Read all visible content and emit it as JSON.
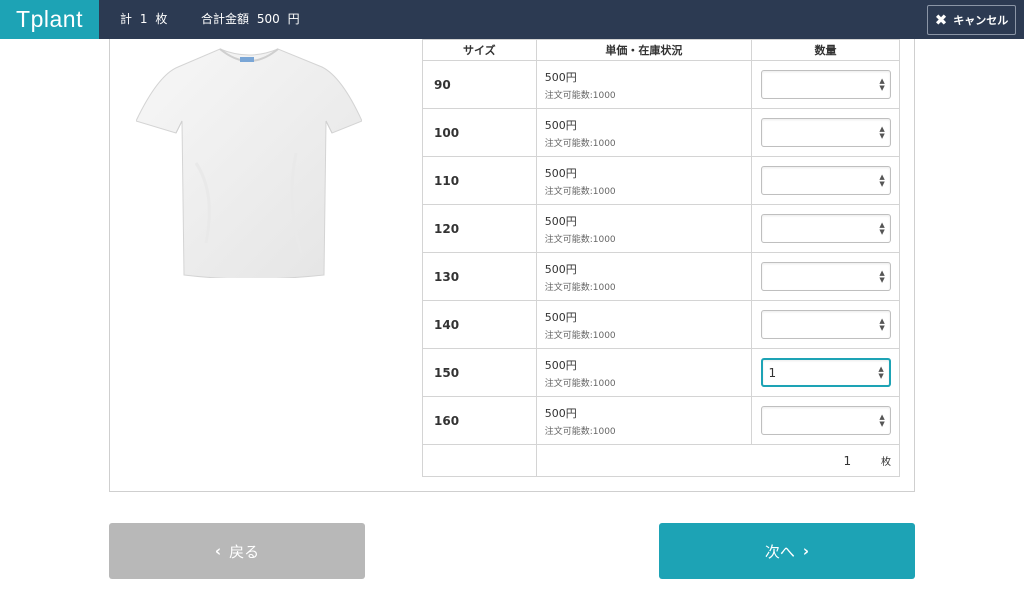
{
  "header": {
    "logo": "Tplant",
    "count_label": "計",
    "count_value": "1",
    "count_unit": "枚",
    "total_label": "合計金額",
    "total_value": "500",
    "total_unit": "円",
    "cancel_label": "キャンセル"
  },
  "table": {
    "headers": [
      "サイズ",
      "単価・在庫状況",
      "数量"
    ],
    "rows": [
      {
        "size": "90",
        "price": "500円",
        "stock": "注文可能数:1000",
        "qty": ""
      },
      {
        "size": "100",
        "price": "500円",
        "stock": "注文可能数:1000",
        "qty": ""
      },
      {
        "size": "110",
        "price": "500円",
        "stock": "注文可能数:1000",
        "qty": ""
      },
      {
        "size": "120",
        "price": "500円",
        "stock": "注文可能数:1000",
        "qty": ""
      },
      {
        "size": "130",
        "price": "500円",
        "stock": "注文可能数:1000",
        "qty": ""
      },
      {
        "size": "140",
        "price": "500円",
        "stock": "注文可能数:1000",
        "qty": ""
      },
      {
        "size": "150",
        "price": "500円",
        "stock": "注文可能数:1000",
        "qty": "1"
      },
      {
        "size": "160",
        "price": "500円",
        "stock": "注文可能数:1000",
        "qty": ""
      }
    ],
    "total_qty": "1",
    "total_unit": "枚"
  },
  "buttons": {
    "back": "戻る",
    "next": "次へ"
  },
  "colors": {
    "header_bg": "#2c3a52",
    "accent": "#1da3b5",
    "back_button": "#b8b8b8"
  }
}
